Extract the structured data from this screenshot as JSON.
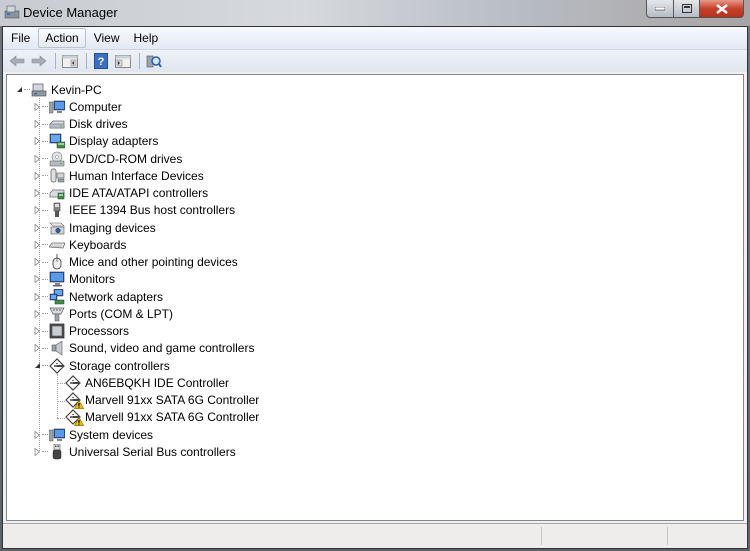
{
  "window": {
    "title": "Device Manager",
    "caption_buttons": {
      "minimize": "minimize",
      "maximize": "maximize",
      "close": "close"
    }
  },
  "menubar": {
    "items": [
      {
        "label": "File"
      },
      {
        "label": "Action",
        "active": true
      },
      {
        "label": "View"
      },
      {
        "label": "Help"
      }
    ]
  },
  "toolbar": {
    "buttons": [
      {
        "icon": "back-arrow-icon",
        "label": "Back"
      },
      {
        "icon": "forward-arrow-icon",
        "label": "Forward"
      },
      {
        "icon": "show-hide-console-tree-icon",
        "label": "Show/Hide Console Tree"
      },
      {
        "icon": "help-icon",
        "label": "Help"
      },
      {
        "icon": "show-hide-action-pane-icon",
        "label": "Show/Hide Action Pane"
      },
      {
        "icon": "scan-hardware-icon",
        "label": "Scan for hardware changes"
      }
    ]
  },
  "tree": {
    "root": {
      "label": "Kevin-PC",
      "expanded": true,
      "icon": "computer-network-icon"
    },
    "categories": [
      {
        "label": "Computer",
        "icon": "computer-icon",
        "expanded": false
      },
      {
        "label": "Disk drives",
        "icon": "disk-drive-icon",
        "expanded": false
      },
      {
        "label": "Display adapters",
        "icon": "display-adapter-icon",
        "expanded": false
      },
      {
        "label": "DVD/CD-ROM drives",
        "icon": "dvd-drive-icon",
        "expanded": false
      },
      {
        "label": "Human Interface Devices",
        "icon": "hid-icon",
        "expanded": false
      },
      {
        "label": "IDE ATA/ATAPI controllers",
        "icon": "ide-controller-icon",
        "expanded": false
      },
      {
        "label": "IEEE 1394 Bus host controllers",
        "icon": "firewire-icon",
        "expanded": false
      },
      {
        "label": "Imaging devices",
        "icon": "camera-icon",
        "expanded": false
      },
      {
        "label": "Keyboards",
        "icon": "keyboard-icon",
        "expanded": false
      },
      {
        "label": "Mice and other pointing devices",
        "icon": "mouse-icon",
        "expanded": false
      },
      {
        "label": "Monitors",
        "icon": "monitor-icon",
        "expanded": false
      },
      {
        "label": "Network adapters",
        "icon": "network-adapter-icon",
        "expanded": false
      },
      {
        "label": "Ports (COM & LPT)",
        "icon": "port-icon",
        "expanded": false
      },
      {
        "label": "Processors",
        "icon": "processor-icon",
        "expanded": false
      },
      {
        "label": "Sound, video and game controllers",
        "icon": "speaker-icon",
        "expanded": false
      },
      {
        "label": "Storage controllers",
        "icon": "storage-controller-icon",
        "expanded": true,
        "children": [
          {
            "label": "AN6EBQKH IDE Controller",
            "icon": "storage-controller-icon",
            "warning": false
          },
          {
            "label": "Marvell 91xx SATA 6G Controller",
            "icon": "storage-controller-icon",
            "warning": true
          },
          {
            "label": "Marvell 91xx SATA 6G Controller",
            "icon": "storage-controller-icon",
            "warning": true
          }
        ]
      },
      {
        "label": "System devices",
        "icon": "system-devices-icon",
        "expanded": false
      },
      {
        "label": "Universal Serial Bus controllers",
        "icon": "usb-icon",
        "expanded": false
      }
    ]
  },
  "statusbar": {
    "text": ""
  },
  "colors": {
    "close_button": "#c7402a",
    "menubar_bg": "#e3e9f3",
    "tree_bg": "#ffffff",
    "warning": "#f2c200"
  }
}
